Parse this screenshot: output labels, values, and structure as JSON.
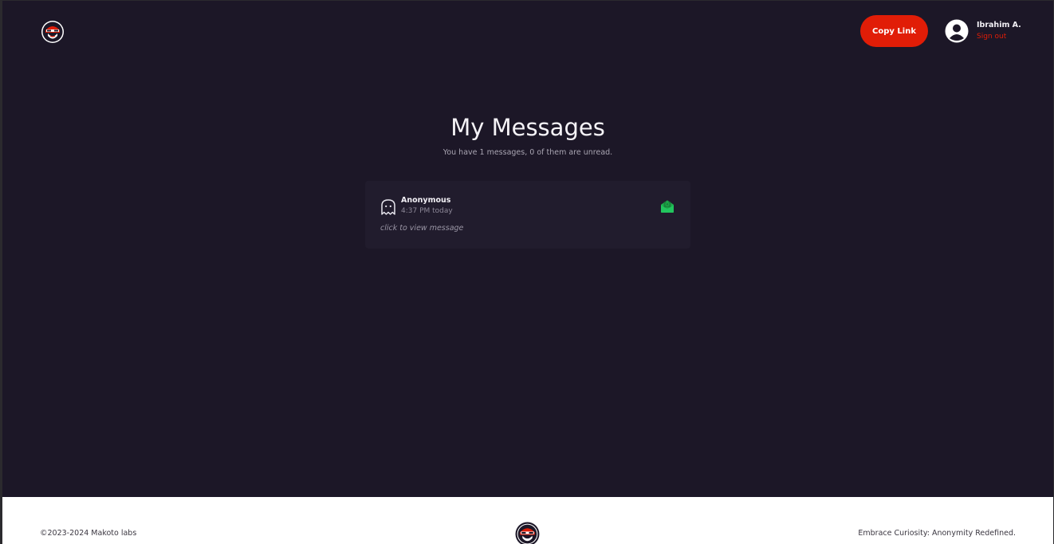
{
  "header": {
    "logo_icon": "makoto-mascot-icon",
    "copy_link_label": "Copy Link",
    "user": {
      "name": "Ibrahim A.",
      "sign_out_label": "Sign out",
      "avatar_icon": "user-circle-icon"
    }
  },
  "main": {
    "title": "My Messages",
    "summary": "You have 1 messages, 0 of them are unread.",
    "messages": [
      {
        "sender": "Anonymous",
        "time": "4:37 PM today",
        "hint": "click to view message",
        "sender_icon": "ghost-icon",
        "status_icon": "envelope-open-icon"
      }
    ]
  },
  "footer": {
    "copyright": "©2023-2024 Makoto labs",
    "tagline": "Embrace Curiosity: Anonymity Redefined.",
    "logo_icon": "makoto-mascot-icon"
  },
  "colors": {
    "background": "#1c1727",
    "card": "#211c2d",
    "accent": "#e11d07",
    "read_status": "#1fae4d",
    "footer": "#ffffff"
  }
}
